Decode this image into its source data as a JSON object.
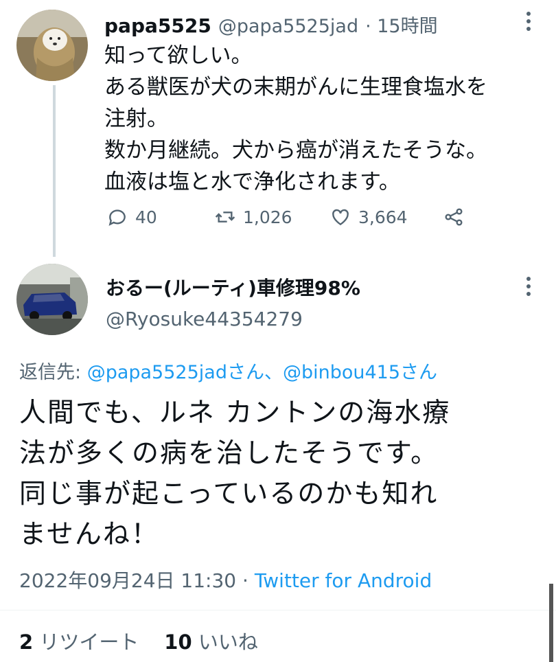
{
  "tweet1": {
    "display_name": "papa5525",
    "handle": "@papa5525jad",
    "time": "· 15時間",
    "lines": [
      "知って欲しい。",
      "ある獣医が犬の末期がんに生理食塩水を",
      "注射。",
      "数か月継続。犬から癌が消えたそうな。",
      "血液は塩と水で浄化されます。"
    ],
    "replies": "40",
    "retweets": "1,026",
    "likes": "3,664"
  },
  "tweet2": {
    "display_name": "おるー(ルーティ)車修理98%",
    "handle": "@Ryosuke44354279",
    "reply_prefix": "返信先: ",
    "reply_mentions": "@papa5525jadさん、@binbou415さん",
    "lines": [
      "人間でも、ルネ カントンの海水療",
      "法が多くの病を治したそうです。",
      "同じ事が起こっているのかも知れ",
      "ませんね！"
    ],
    "timestamp": "2022年09月24日 11:30 · ",
    "client": "Twitter for Android",
    "retweet_count": "2",
    "retweet_label": " リツイート",
    "like_count": "10",
    "like_label": " いいね"
  },
  "icons": {
    "reply": "reply-icon",
    "retweet": "retweet-icon",
    "like": "heart-icon",
    "share": "share-icon",
    "more": "more-icon"
  },
  "colors": {
    "link": "#1d9bf0",
    "muted": "#536471",
    "text": "#0f1419"
  }
}
